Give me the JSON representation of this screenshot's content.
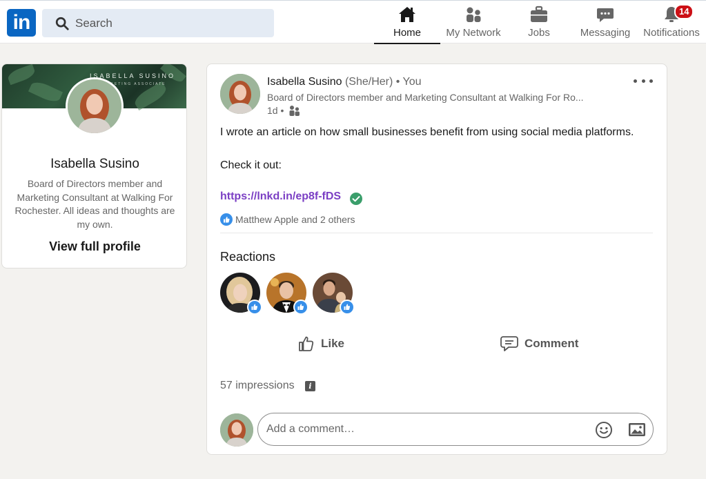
{
  "header": {
    "logo_text": "in",
    "search_placeholder": "Search",
    "nav": [
      {
        "label": "Home",
        "icon": "home-icon",
        "active": true
      },
      {
        "label": "My Network",
        "icon": "network-icon"
      },
      {
        "label": "Jobs",
        "icon": "briefcase-icon"
      },
      {
        "label": "Messaging",
        "icon": "chat-icon"
      },
      {
        "label": "Notifications",
        "icon": "bell-icon",
        "badge": "14"
      }
    ]
  },
  "profile": {
    "banner_title": "ISABELLA SUSINO",
    "banner_subtitle": "MARKETING ASSOCIATE",
    "name": "Isabella Susino",
    "headline": "Board of Directors member and Marketing Consultant at Walking For Rochester. All ideas and thoughts are my own.",
    "view_profile": "View full profile"
  },
  "post": {
    "author": "Isabella Susino",
    "pronouns": "(She/Her)",
    "relation": "• You",
    "headline": "Board of Directors member and Marketing Consultant at Walking For Ro...",
    "time": "1d •",
    "body_line1": "I wrote an article on how small businesses benefit from using social media platforms.",
    "body_line2": "Check it out:",
    "link": "https://lnkd.in/ep8f-fDS",
    "likes_summary": "Matthew Apple and 2 others",
    "reactions_title": "Reactions",
    "actions": {
      "like": "Like",
      "comment": "Comment"
    },
    "impressions": "57 impressions",
    "info_glyph": "i",
    "comment_placeholder": "Add a comment…"
  },
  "colors": {
    "brand": "#0a66c2",
    "link": "#7b3fc4",
    "badge": "#cc1016",
    "verified": "#3a9e6b"
  }
}
